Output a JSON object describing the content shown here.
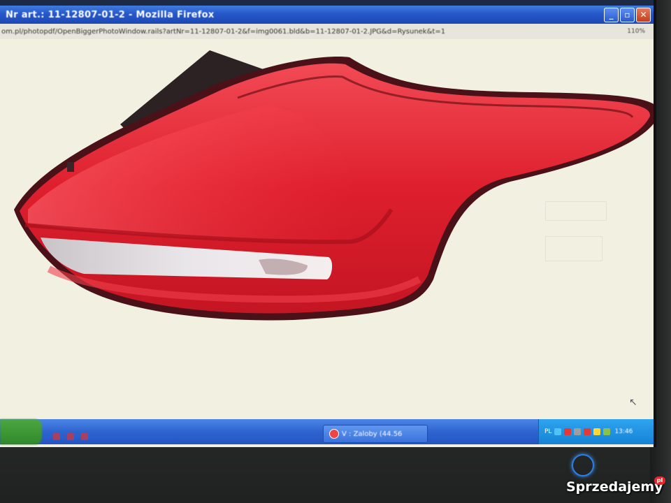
{
  "window": {
    "title": "Nr art.: 11-12807-01-2 - Mozilla Firefox",
    "buttons": [
      "_",
      "▫",
      "✕"
    ]
  },
  "addressbar": {
    "url": "om.pl/photopdf/OpenBiggerPhotoWindow.rails?artNr=11-12807-01-2&f=img0061.bld&b=11-12807-01-2.JPG&d=Rysunek&t=1",
    "zoom": "110%"
  },
  "taskbar": {
    "task_label": "V : Zaloby (44.56",
    "tray_lang": "PL",
    "clock": "13:46"
  },
  "monitor": {
    "brand": ""
  },
  "watermark": {
    "text": "Sprzedajemy",
    "suffix": "pl"
  },
  "colors": {
    "titlebar": "#2657c9",
    "taskbar": "#2e63d0",
    "lamp_red": "#d9202c"
  },
  "icons": [
    "close-icon",
    "maximize-icon",
    "minimize-icon",
    "firefox-icon",
    "mouse-cursor-icon",
    "power-icon"
  ]
}
